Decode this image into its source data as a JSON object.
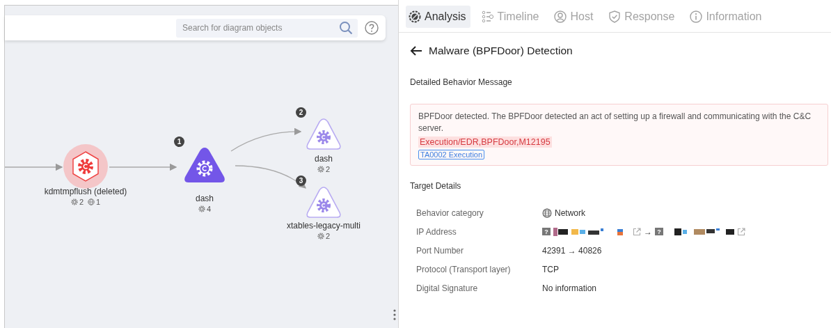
{
  "diagram": {
    "search": {
      "placeholder": "Search for diagram objects"
    },
    "nodes": [
      {
        "kind": "deleted",
        "name": "kdmtmpflush (deleted)",
        "counts": [
          {
            "kind": "process",
            "value": "2"
          },
          {
            "kind": "network",
            "value": "1"
          }
        ]
      },
      {
        "kind": "primary",
        "order": "1",
        "name": "dash",
        "counts": [
          {
            "kind": "process",
            "value": "4"
          }
        ]
      },
      {
        "kind": "child",
        "order": "2",
        "name": "dash",
        "counts": [
          {
            "kind": "process",
            "value": "2"
          }
        ]
      },
      {
        "kind": "child",
        "order": "3",
        "name": "xtables-legacy-multi",
        "counts": [
          {
            "kind": "process",
            "value": "2"
          }
        ]
      }
    ]
  },
  "tabs": [
    {
      "label": "Analysis",
      "selected": true
    },
    {
      "label": "Timeline",
      "selected": false
    },
    {
      "label": "Host",
      "selected": false
    },
    {
      "label": "Response",
      "selected": false
    },
    {
      "label": "Information",
      "selected": false
    }
  ],
  "detail": {
    "title": "Malware (BPFDoor) Detection",
    "message_section": {
      "heading": "Detailed Behavior Message",
      "text": "BPFDoor detected. The BPFDoor detected an act of setting up a firewall and communicating with the C&C server.",
      "rule": "Execution/EDR,BPFDoor,M12195",
      "tactic": "TA0002 Execution"
    },
    "target_section": {
      "heading": "Target Details",
      "rows": [
        {
          "kind": "category",
          "label": "Behavior category",
          "value": "Network"
        },
        {
          "kind": "ip",
          "label": "IP Address",
          "source_flag": "?",
          "separator": "→",
          "dest_flag": "?"
        },
        {
          "kind": "text",
          "label": "Port Number",
          "value": "42391 → 40826"
        },
        {
          "kind": "text",
          "label": "Protocol (Transport layer)",
          "value": "TCP"
        },
        {
          "kind": "text",
          "label": "Digital Signature",
          "value": "No information"
        }
      ]
    }
  }
}
